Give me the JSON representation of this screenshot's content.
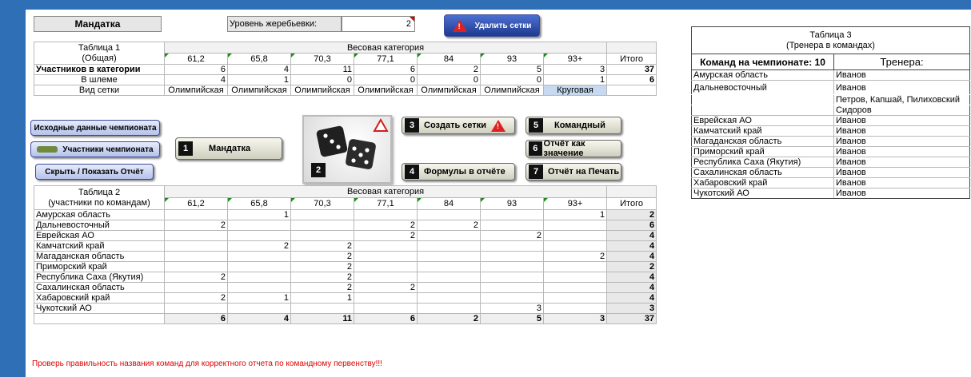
{
  "top": {
    "mandatka_label": "Мандатка",
    "draw_level_label": "Уровень жеребьевки:",
    "draw_level_value": "2",
    "delete_grids_label": "Удалить сетки"
  },
  "table1": {
    "title_line1": "Таблица 1",
    "title_line2": "(Общая)",
    "weight_header": "Весовая категория",
    "total_header": "Итого",
    "categories": [
      "61,2",
      "65,8",
      "70,3",
      "77,1",
      "84",
      "93",
      "93+"
    ],
    "participants_label": "Участников в категории",
    "participants": [
      "6",
      "4",
      "11",
      "6",
      "2",
      "5",
      "3"
    ],
    "participants_total": "37",
    "helmet_label": "В шлеме",
    "helmet": [
      "4",
      "1",
      "0",
      "0",
      "0",
      "0",
      "1"
    ],
    "helmet_total": "6",
    "grid_type_label": "Вид сетки",
    "grid_types": [
      "Олимпийская",
      "Олимпийская",
      "Олимпийская",
      "Олимпийская",
      "Олимпийская",
      "Олимпийская",
      "Круговая"
    ]
  },
  "buttons": {
    "source_data": "Исходные данные чемпионата",
    "participants": "Участники чемпионата",
    "hide_show": "Скрыть / Показать Отчёт",
    "b1_num": "1",
    "b1": "Мандатка",
    "b2_num": "2",
    "b3_num": "3",
    "b3": "Создать сетки",
    "b4_num": "4",
    "b4": "Формулы в отчёте",
    "b5_num": "5",
    "b5": "Командный",
    "b6_num": "6",
    "b6": "Отчёт как значение",
    "b7_num": "7",
    "b7": "Отчёт на Печать"
  },
  "table2": {
    "title_line1": "Таблица 2",
    "title_line2": "(участники по командам)",
    "weight_header": "Весовая категория",
    "total_header": "Итого",
    "categories": [
      "61,2",
      "65,8",
      "70,3",
      "77,1",
      "84",
      "93",
      "93+"
    ],
    "rows": [
      {
        "team": "Амурская область",
        "vals": [
          "",
          "1",
          "",
          "",
          "",
          "",
          "1"
        ],
        "total": "2"
      },
      {
        "team": "Дальневосточный",
        "vals": [
          "2",
          "",
          "",
          "2",
          "2",
          "",
          ""
        ],
        "total": "6"
      },
      {
        "team": "Еврейская АО",
        "vals": [
          "",
          "",
          "",
          "2",
          "",
          "2",
          ""
        ],
        "total": "4"
      },
      {
        "team": "Камчатский край",
        "vals": [
          "",
          "2",
          "2",
          "",
          "",
          "",
          ""
        ],
        "total": "4"
      },
      {
        "team": "Магаданская область",
        "vals": [
          "",
          "",
          "2",
          "",
          "",
          "",
          "2"
        ],
        "total": "4"
      },
      {
        "team": "Приморский край",
        "vals": [
          "",
          "",
          "2",
          "",
          "",
          "",
          ""
        ],
        "total": "2"
      },
      {
        "team": "Республика Саха (Якутия)",
        "vals": [
          "2",
          "",
          "2",
          "",
          "",
          "",
          ""
        ],
        "total": "4"
      },
      {
        "team": "Сахалинская область",
        "vals": [
          "",
          "",
          "2",
          "2",
          "",
          "",
          ""
        ],
        "total": "4"
      },
      {
        "team": "Хабаровский край",
        "vals": [
          "2",
          "1",
          "1",
          "",
          "",
          "",
          ""
        ],
        "total": "4"
      },
      {
        "team": "Чукотский АО",
        "vals": [
          "",
          "",
          "",
          "",
          "",
          "3",
          ""
        ],
        "total": "3"
      }
    ],
    "col_totals": [
      "6",
      "4",
      "11",
      "6",
      "2",
      "5",
      "3"
    ],
    "grand_total": "37"
  },
  "table3": {
    "title_line1": "Таблица 3",
    "title_line2": "(Тренера в командах)",
    "teams_header": "Команд на чемпионате: 10",
    "coach_header": "Тренера:",
    "rows": [
      {
        "team": "Амурская область",
        "coach": "Иванов"
      },
      {
        "team": "Дальневосточный",
        "coach": "Иванов"
      },
      {
        "team": "",
        "coach": "Петров, Капшай, Пилиховский"
      },
      {
        "team": "",
        "coach": "Сидоров"
      },
      {
        "team": "Еврейская АО",
        "coach": "Иванов"
      },
      {
        "team": "Камчатский край",
        "coach": "Иванов"
      },
      {
        "team": "Магаданская область",
        "coach": "Иванов"
      },
      {
        "team": "Приморский край",
        "coach": "Иванов"
      },
      {
        "team": "Республика Саха (Якутия)",
        "coach": "Иванов"
      },
      {
        "team": "Сахалинская область",
        "coach": "Иванов"
      },
      {
        "team": "Хабаровский край",
        "coach": "Иванов"
      },
      {
        "team": "Чукотский АО",
        "coach": "Иванов"
      }
    ]
  },
  "footnote": "Проверь правильность названия команд для корректного отчета по командному первенству!!!",
  "colors": {
    "frame": "#2f6fb5",
    "warning": "#e00000",
    "circular": "#c6d9f0"
  }
}
